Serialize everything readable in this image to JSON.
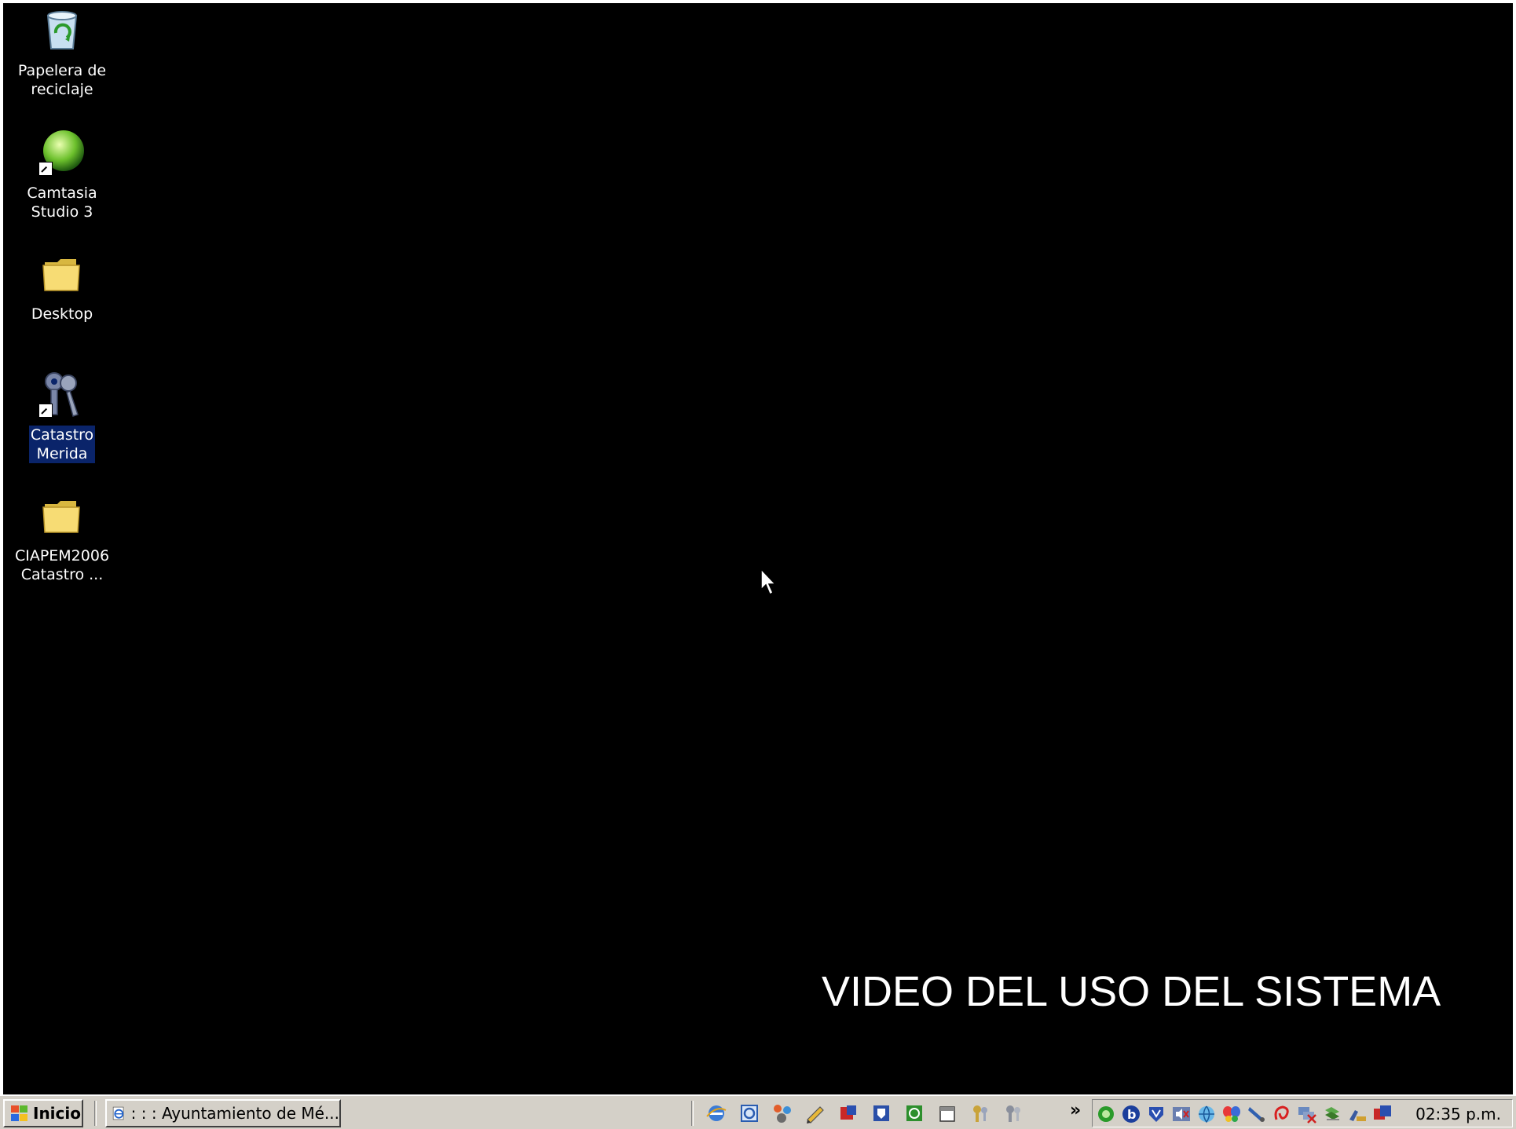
{
  "desktop": {
    "icons": [
      {
        "name": "recycle-bin",
        "line1": "Papelera de",
        "line2": "reciclaje",
        "selected": false
      },
      {
        "name": "camtasia",
        "line1": "Camtasia",
        "line2": "Studio 3",
        "selected": false
      },
      {
        "name": "desktop-folder",
        "line1": "Desktop",
        "line2": "",
        "selected": false
      },
      {
        "name": "catastro-merida",
        "line1": "Catastro",
        "line2": "Merida",
        "selected": true
      },
      {
        "name": "ciapem-folder",
        "line1": "CIAPEM2006",
        "line2": "Catastro ...",
        "selected": false
      }
    ],
    "overlay_title": "VIDEO DEL USO DEL SISTEMA"
  },
  "taskbar": {
    "start_label": "Inicio",
    "task_label": ": : : Ayuntamiento de Mé...",
    "chevron": "»",
    "clock": "02:35 p.m.",
    "quick_launch_icons": [
      "ie-icon",
      "outlook-express-icon",
      "network-icon",
      "pencil-icon",
      "app-red-icon",
      "shield-icon",
      "green-clock-icon",
      "calendar-icon",
      "keys-icon",
      "keys-gray-icon"
    ],
    "tray_icons": [
      "green-circle-icon",
      "b-icon",
      "mcafee-icon",
      "volume-muted-icon",
      "network-globe-icon",
      "butterfly-icon",
      "pen-icon",
      "red-swirl-icon",
      "network-error-icon",
      "recycle-tray-icon",
      "printer-icon",
      "app-blue-icon"
    ]
  }
}
